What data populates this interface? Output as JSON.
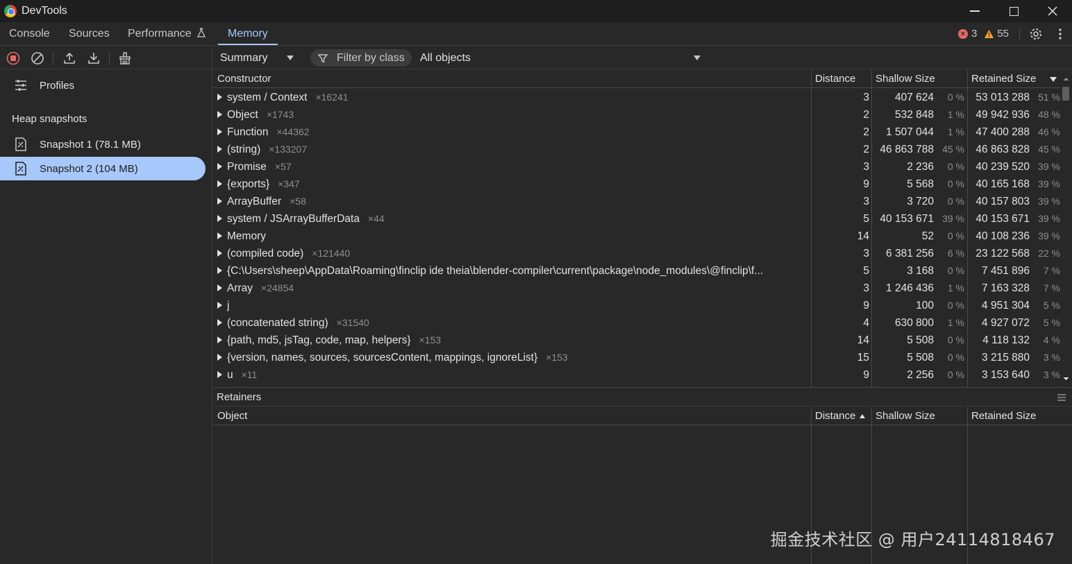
{
  "window": {
    "title": "DevTools"
  },
  "tabs": [
    {
      "label": "Console"
    },
    {
      "label": "Sources"
    },
    {
      "label": "Performance"
    },
    {
      "label": "Memory"
    }
  ],
  "status": {
    "errors": "3",
    "warnings": "55"
  },
  "sidebar": {
    "profiles_label": "Profiles",
    "section_title": "Heap snapshots",
    "snapshots": [
      {
        "label": "Snapshot 1 (78.1 MB)"
      },
      {
        "label": "Snapshot 2 (104 MB)"
      }
    ]
  },
  "toolbar": {
    "view": "Summary",
    "filter_placeholder": "Filter by class",
    "scope": "All objects"
  },
  "table": {
    "headers": {
      "constructor": "Constructor",
      "distance": "Distance",
      "shallow": "Shallow Size",
      "retained": "Retained Size"
    },
    "rows": [
      {
        "name": "system / Context",
        "count": "×16241",
        "distance": "3",
        "shallow": "407 624",
        "shallow_pct": "0 %",
        "retained": "53 013 288",
        "retained_pct": "51 %"
      },
      {
        "name": "Object",
        "count": "×1743",
        "distance": "2",
        "shallow": "532 848",
        "shallow_pct": "1 %",
        "retained": "49 942 936",
        "retained_pct": "48 %"
      },
      {
        "name": "Function",
        "count": "×44362",
        "distance": "2",
        "shallow": "1 507 044",
        "shallow_pct": "1 %",
        "retained": "47 400 288",
        "retained_pct": "46 %"
      },
      {
        "name": "(string)",
        "count": "×133207",
        "distance": "2",
        "shallow": "46 863 788",
        "shallow_pct": "45 %",
        "retained": "46 863 828",
        "retained_pct": "45 %"
      },
      {
        "name": "Promise",
        "count": "×57",
        "distance": "3",
        "shallow": "2 236",
        "shallow_pct": "0 %",
        "retained": "40 239 520",
        "retained_pct": "39 %"
      },
      {
        "name": "{exports}",
        "count": "×347",
        "distance": "9",
        "shallow": "5 568",
        "shallow_pct": "0 %",
        "retained": "40 165 168",
        "retained_pct": "39 %"
      },
      {
        "name": "ArrayBuffer",
        "count": "×58",
        "distance": "3",
        "shallow": "3 720",
        "shallow_pct": "0 %",
        "retained": "40 157 803",
        "retained_pct": "39 %"
      },
      {
        "name": "system / JSArrayBufferData",
        "count": "×44",
        "distance": "5",
        "shallow": "40 153 671",
        "shallow_pct": "39 %",
        "retained": "40 153 671",
        "retained_pct": "39 %"
      },
      {
        "name": "Memory",
        "count": "",
        "distance": "14",
        "shallow": "52",
        "shallow_pct": "0 %",
        "retained": "40 108 236",
        "retained_pct": "39 %"
      },
      {
        "name": "(compiled code)",
        "count": "×121440",
        "distance": "3",
        "shallow": "6 381 256",
        "shallow_pct": "6 %",
        "retained": "23 122 568",
        "retained_pct": "22 %"
      },
      {
        "name": "{C:\\Users\\sheep\\AppData\\Roaming\\finclip ide theia\\blender-compiler\\current\\package\\node_modules\\@finclip\\f...",
        "count": "",
        "distance": "5",
        "shallow": "3 168",
        "shallow_pct": "0 %",
        "retained": "7 451 896",
        "retained_pct": "7 %"
      },
      {
        "name": "Array",
        "count": "×24854",
        "distance": "3",
        "shallow": "1 246 436",
        "shallow_pct": "1 %",
        "retained": "7 163 328",
        "retained_pct": "7 %"
      },
      {
        "name": "j",
        "count": "",
        "distance": "9",
        "shallow": "100",
        "shallow_pct": "0 %",
        "retained": "4 951 304",
        "retained_pct": "5 %"
      },
      {
        "name": "(concatenated string)",
        "count": "×31540",
        "distance": "4",
        "shallow": "630 800",
        "shallow_pct": "1 %",
        "retained": "4 927 072",
        "retained_pct": "5 %"
      },
      {
        "name": "{path, md5, jsTag, code, map, helpers}",
        "count": "×153",
        "distance": "14",
        "shallow": "5 508",
        "shallow_pct": "0 %",
        "retained": "4 118 132",
        "retained_pct": "4 %"
      },
      {
        "name": "{version, names, sources, sourcesContent, mappings, ignoreList}",
        "count": "×153",
        "distance": "15",
        "shallow": "5 508",
        "shallow_pct": "0 %",
        "retained": "3 215 880",
        "retained_pct": "3 %"
      },
      {
        "name": "u",
        "count": "×11",
        "distance": "9",
        "shallow": "2 256",
        "shallow_pct": "0 %",
        "retained": "3 153 640",
        "retained_pct": "3 %"
      }
    ]
  },
  "retainers": {
    "title": "Retainers",
    "headers": {
      "object": "Object",
      "distance": "Distance",
      "shallow": "Shallow Size",
      "retained": "Retained Size"
    }
  },
  "watermark": "掘金技术社区 @ 用户24114818467",
  "icons": {
    "app": "chrome-icon",
    "minimize": "minimize-icon",
    "maximize": "maximize-icon",
    "close": "close-icon",
    "error": "error-icon",
    "warning": "warning-icon",
    "settings": "gear-icon",
    "more": "kebab-icon",
    "record": "stop-recording-icon",
    "clear": "clear-icon",
    "upload": "upload-icon",
    "download": "download-icon",
    "gc": "broom-icon",
    "profiles": "sliders-icon",
    "snapshot": "heap-snapshot-icon",
    "filter": "filter-icon"
  },
  "colors": {
    "accent": "#a8c7fa",
    "error": "#e46962",
    "warning": "#f4a52a"
  }
}
